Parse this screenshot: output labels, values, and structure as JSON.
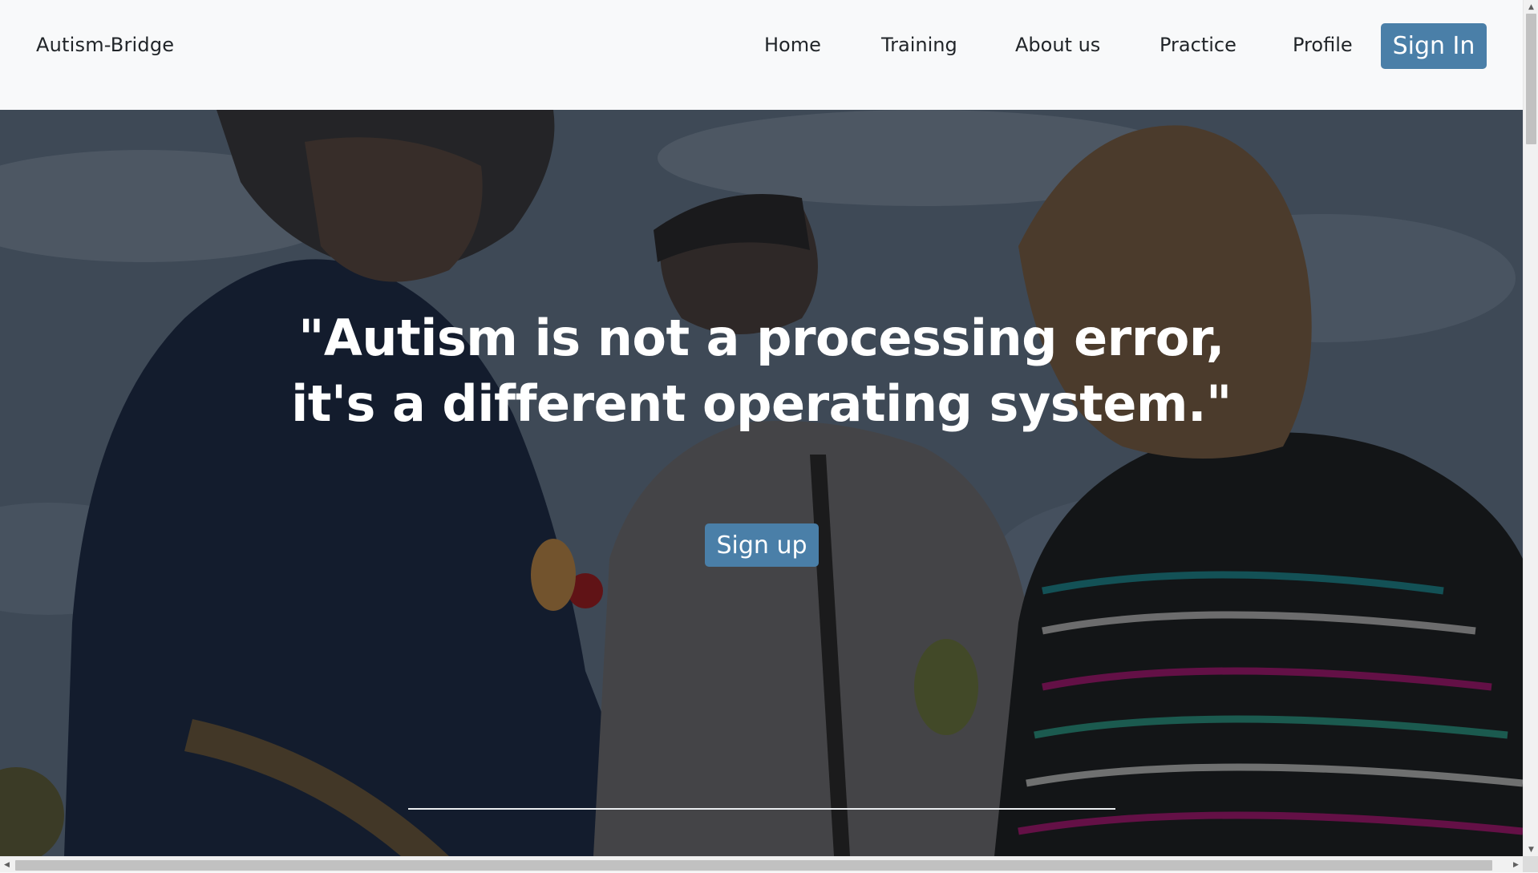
{
  "navbar": {
    "brand": "Autism-Bridge",
    "links": [
      {
        "label": "Home"
      },
      {
        "label": "Training"
      },
      {
        "label": "About us"
      },
      {
        "label": "Practice"
      },
      {
        "label": "Profile"
      }
    ],
    "signin_label": "Sign In"
  },
  "hero": {
    "quote_line1": "\"Autism is not a processing error,",
    "quote_line2": "it's a different operating system.\"",
    "signup_label": "Sign up"
  },
  "scrollbars": {
    "up_arrow": "▲",
    "down_arrow": "▼",
    "left_arrow": "◀",
    "right_arrow": "▶"
  },
  "colors": {
    "accent": "#4a7fa8",
    "navbar_bg": "#f8f9fa",
    "text_dark": "#212529",
    "hero_text": "#ffffff"
  }
}
